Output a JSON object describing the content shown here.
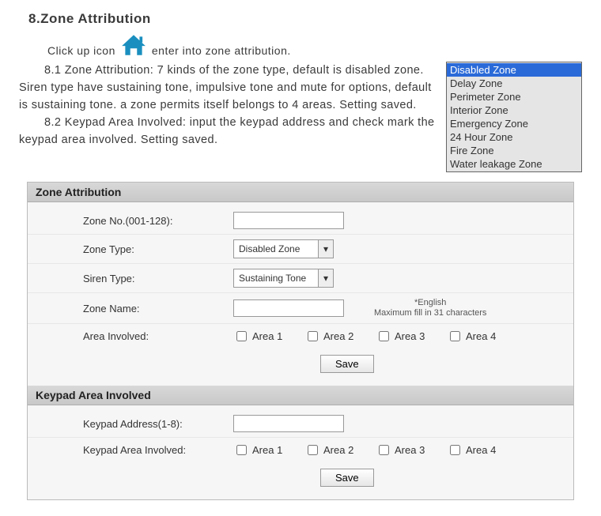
{
  "title": "8.Zone Attribution",
  "intro": {
    "before": "Click up icon",
    "after": "enter into zone attribution."
  },
  "para1": "8.1 Zone Attribution: 7 kinds of the zone type, default is disabled zone. Siren type have sustaining tone, impulsive tone and mute for options, default is sustaining tone. a zone permits itself belongs to 4 areas. Setting saved.",
  "para2": "8.2 Keypad Area Involved: input the keypad address and check mark the keypad area involved. Setting saved.",
  "zoneTypes": {
    "items": [
      "Disabled Zone",
      "Delay Zone",
      "Perimeter Zone",
      "Interior Zone",
      "Emergency Zone",
      "24 Hour Zone",
      "Fire Zone",
      "Water leakage Zone"
    ],
    "selectedIndex": 0
  },
  "panel1": {
    "header": "Zone Attribution",
    "fields": {
      "zoneNo": {
        "label": "Zone No.(001-128):",
        "value": ""
      },
      "zoneType": {
        "label": "Zone Type:",
        "value": "Disabled Zone"
      },
      "sirenType": {
        "label": "Siren Type:",
        "value": "Sustaining Tone"
      },
      "zoneName": {
        "label": "Zone Name:",
        "value": "",
        "hintTitle": "*English",
        "hintBody": "Maximum fill in 31 characters"
      },
      "areaInvolved": {
        "label": "Area Involved:"
      }
    },
    "areas": [
      "Area 1",
      "Area 2",
      "Area 3",
      "Area 4"
    ],
    "saveLabel": "Save"
  },
  "panel2": {
    "header": "Keypad Area Involved",
    "fields": {
      "keypadAddr": {
        "label": "Keypad Address(1-8):",
        "value": ""
      },
      "keypadArea": {
        "label": "Keypad Area Involved:"
      }
    },
    "areas": [
      "Area 1",
      "Area 2",
      "Area 3",
      "Area 4"
    ],
    "saveLabel": "Save"
  }
}
